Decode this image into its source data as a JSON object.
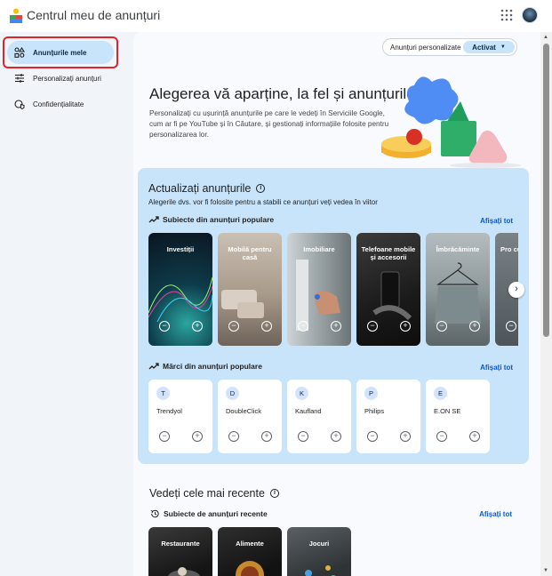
{
  "app": {
    "title": "Centrul meu de anunțuri"
  },
  "sidebar": {
    "items": [
      {
        "label": "Anunțurile mele",
        "icon": "ads-shapes-icon",
        "active": true
      },
      {
        "label": "Personalizați anunțuri",
        "icon": "tune-sliders-icon",
        "active": false
      },
      {
        "label": "Confidențialitate",
        "icon": "privacy-shield-icon",
        "active": false
      }
    ]
  },
  "personalization": {
    "label": "Anunțuri personalizate",
    "value": "Activat"
  },
  "hero": {
    "title": "Alegerea vă aparține, la fel și anunțurile",
    "text": "Personalizați cu ușurință anunțurile pe care le vedeți în Serviciile Google, cum ar fi pe YouTube și în Căutare, și gestionați informațiile folosite pentru personalizarea lor."
  },
  "update_panel": {
    "title": "Actualizați anunțurile",
    "subtitle": "Alegerile dvs. vor fi folosite pentru a stabili ce anunțuri veți vedea în viitor",
    "topics_heading": "Subiecte din anunțuri populare",
    "topics_show_all": "Afișați tot",
    "topics": [
      {
        "label": "Investiții"
      },
      {
        "label": "Mobilă pentru casă"
      },
      {
        "label": "Imobiliare"
      },
      {
        "label": "Telefoane mobile și accesorii"
      },
      {
        "label": "Îmbrăcăminte"
      },
      {
        "label": "Pro cură"
      }
    ],
    "brands_heading": "Mărci din anunțuri populare",
    "brands_show_all": "Afișați tot",
    "brands": [
      {
        "initial": "T",
        "name": "Trendyol"
      },
      {
        "initial": "D",
        "name": "DoubleClick"
      },
      {
        "initial": "K",
        "name": "Kaufland"
      },
      {
        "initial": "P",
        "name": "Philips"
      },
      {
        "initial": "E",
        "name": "E.ON SE"
      }
    ]
  },
  "recent": {
    "title": "Vedeți cele mai recente",
    "heading": "Subiecte de anunțuri recente",
    "show_all": "Afișați tot",
    "items": [
      {
        "label": "Restaurante"
      },
      {
        "label": "Alimente"
      },
      {
        "label": "Jocuri"
      }
    ]
  },
  "controls": {
    "minus": "−",
    "plus": "+",
    "next": "›",
    "info": "i"
  },
  "colors": {
    "accent": "#c8e4fb",
    "link": "#0b57d0",
    "highlight_border": "#e0242b",
    "background": "#f1f4f9"
  }
}
